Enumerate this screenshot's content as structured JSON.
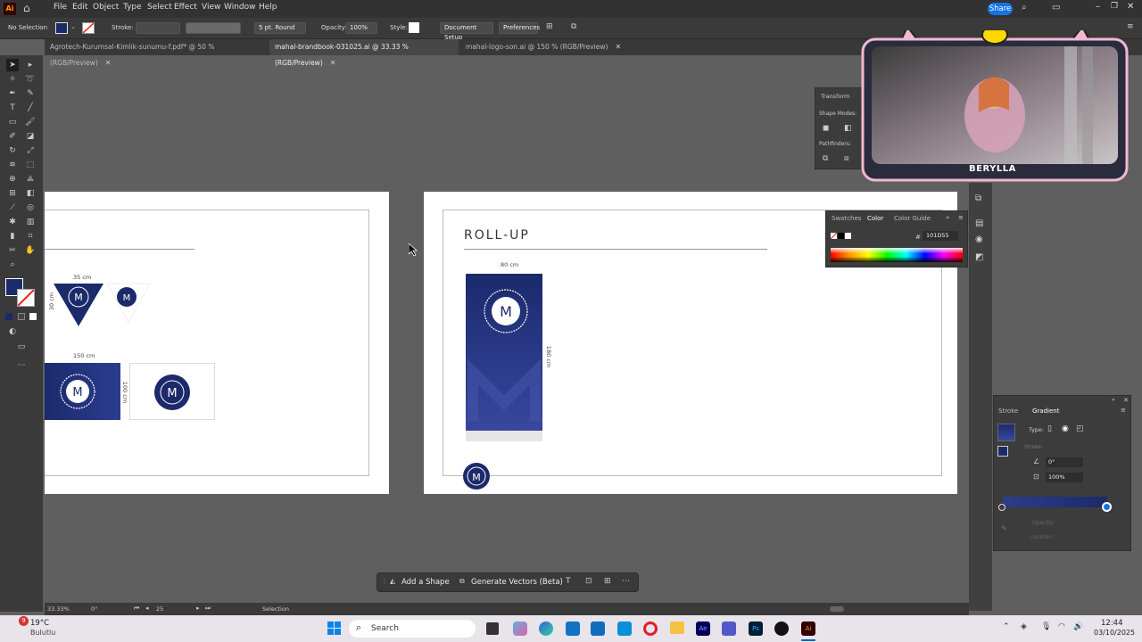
{
  "menubar": {
    "app_logo": "Ai",
    "items": [
      "File",
      "Edit",
      "Object",
      "Type",
      "Select",
      "Effect",
      "View",
      "Window",
      "Help"
    ],
    "share_label": "Share"
  },
  "controlbar": {
    "selection_status": "No Selection",
    "stroke_label": "Stroke:",
    "brush_label": "5 pt. Round",
    "opacity_label": "Opacity:",
    "opacity_value": "100%",
    "style_label": "Style:",
    "doc_setup": "Document Setup",
    "preferences": "Preferences"
  },
  "tabs": [
    {
      "label": "Agrotech-Kurumsal-Kimlik-sunumu-f.pdf* @ 50 % (RGB/Preview)",
      "active": false
    },
    {
      "label": "mahal-brandbook-031025.ai @ 33.33 % (RGB/Preview)",
      "active": true
    },
    {
      "label": "mahal-logo-son.ai @ 150 % (RGB/Preview)",
      "active": false
    }
  ],
  "left_artboard": {
    "flag_width": "35 cm",
    "flag_height": "30 cm",
    "banner_width": "150 cm",
    "banner_height": "100 cm"
  },
  "right_artboard": {
    "title": "ROLL-UP",
    "rollup_width": "80 cm",
    "rollup_height": "180 cm"
  },
  "logo": {
    "letter": "M",
    "ring_text": "MAHAL GAYRİMENKUL DANIŞMANLIK"
  },
  "transform_panel": {
    "title": "Transform",
    "shape_modes": "Shape Modes:",
    "pathfinders": "Pathfinders:"
  },
  "color_panel": {
    "tabs": [
      "Swatches",
      "Color",
      "Color Guide"
    ],
    "active_tab": "Color",
    "hex_symbol": "#",
    "hex_value": "101D55"
  },
  "gradient_panel": {
    "tabs": [
      "Stroke",
      "Gradient"
    ],
    "active_tab": "Gradient",
    "type_label": "Type:",
    "stroke_label": "Stroke:",
    "angle_value": "0°",
    "aspect_value": "100%",
    "opacity_label": "Opacity:",
    "location_label": "Location:"
  },
  "webcam": {
    "streamer_name": "BERYLLA"
  },
  "context_bar": {
    "add_shape": "Add a Shape",
    "generate_vectors": "Generate Vectors (Beta)"
  },
  "statusbar": {
    "zoom": "33.33%",
    "rotation": "0°",
    "artboard_num": "25",
    "tool_name": "Selection"
  },
  "taskbar": {
    "weather_temp": "19°C",
    "weather_desc": "Bulutlu",
    "notification_count": "9",
    "search_label": "Search",
    "time": "12:44",
    "date": "03/10/2025"
  },
  "colors": {
    "navy": "#1b2a6b",
    "accent_blue": "#1473e6",
    "panel_bg": "#3c3c3c"
  }
}
